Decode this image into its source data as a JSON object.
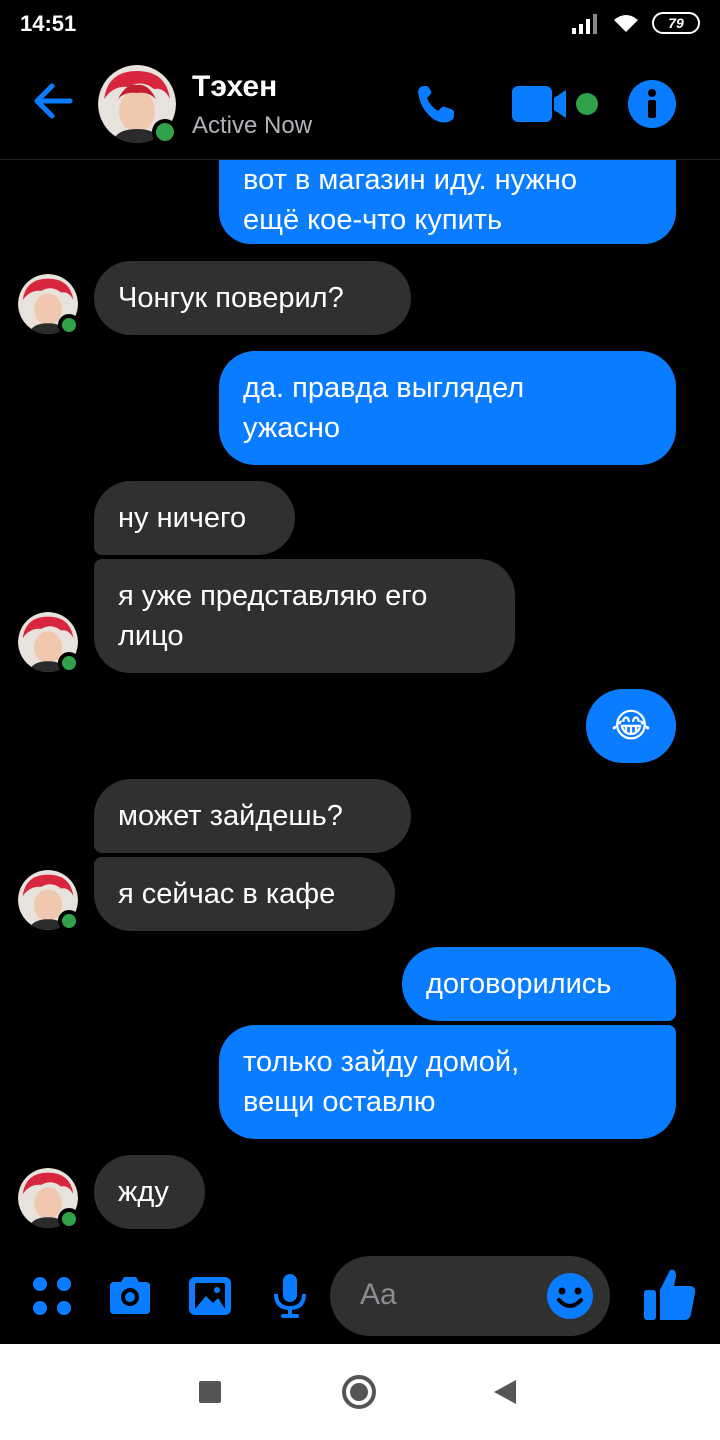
{
  "status_bar": {
    "time": "14:51",
    "battery": "79"
  },
  "header": {
    "contact_name": "Тэхен",
    "presence": "Active Now"
  },
  "messages": [
    {
      "side": "out",
      "text": "вот в магазин иду. нужно\nещё кое-что купить"
    },
    {
      "side": "in",
      "text": "Чонгук поверил?"
    },
    {
      "side": "out",
      "text": "да. правда выглядел\nужасно"
    },
    {
      "side": "in",
      "text": "ну ничего"
    },
    {
      "side": "in",
      "text": "я уже представляю его\nлицо"
    },
    {
      "side": "out",
      "text": "😂"
    },
    {
      "side": "in",
      "text": "может зайдешь?"
    },
    {
      "side": "in",
      "text": "я сейчас в кафе"
    },
    {
      "side": "out",
      "text": "договорились"
    },
    {
      "side": "out",
      "text": "только зайду домой,\nвещи оставлю"
    },
    {
      "side": "in",
      "text": "жду"
    }
  ],
  "composer": {
    "placeholder": "Aa"
  },
  "colors": {
    "accent": "#0a7cff",
    "incoming_bubble": "#303030",
    "online": "#31a24c"
  }
}
